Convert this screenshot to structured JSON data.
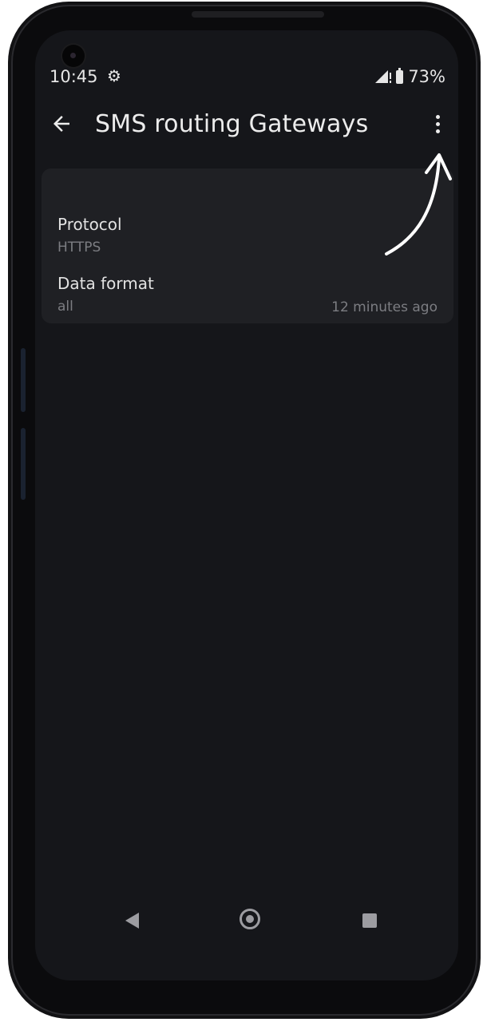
{
  "status_bar": {
    "time": "10:45",
    "settings_icon": "gear-icon",
    "signal_icon": "signal-icon",
    "battery_icon": "battery-icon",
    "battery": "73%"
  },
  "app_bar": {
    "back_icon": "arrow-back-icon",
    "title": "SMS routing Gateways",
    "menu_icon": "more-vert-icon"
  },
  "gateway_card": {
    "protocol_label": "Protocol",
    "protocol_value": "HTTPS",
    "data_format_label": "Data format",
    "data_format_value": "all",
    "updated": "12 minutes ago"
  },
  "nav_bar": {
    "back_icon": "nav-back-icon",
    "home_icon": "nav-home-icon",
    "recents_icon": "nav-recents-icon"
  },
  "colors": {
    "screen_bg": "#15161a",
    "card_bg": "#1f2024",
    "primary_text": "#e2e2e2",
    "secondary_text": "#7c7d82"
  }
}
